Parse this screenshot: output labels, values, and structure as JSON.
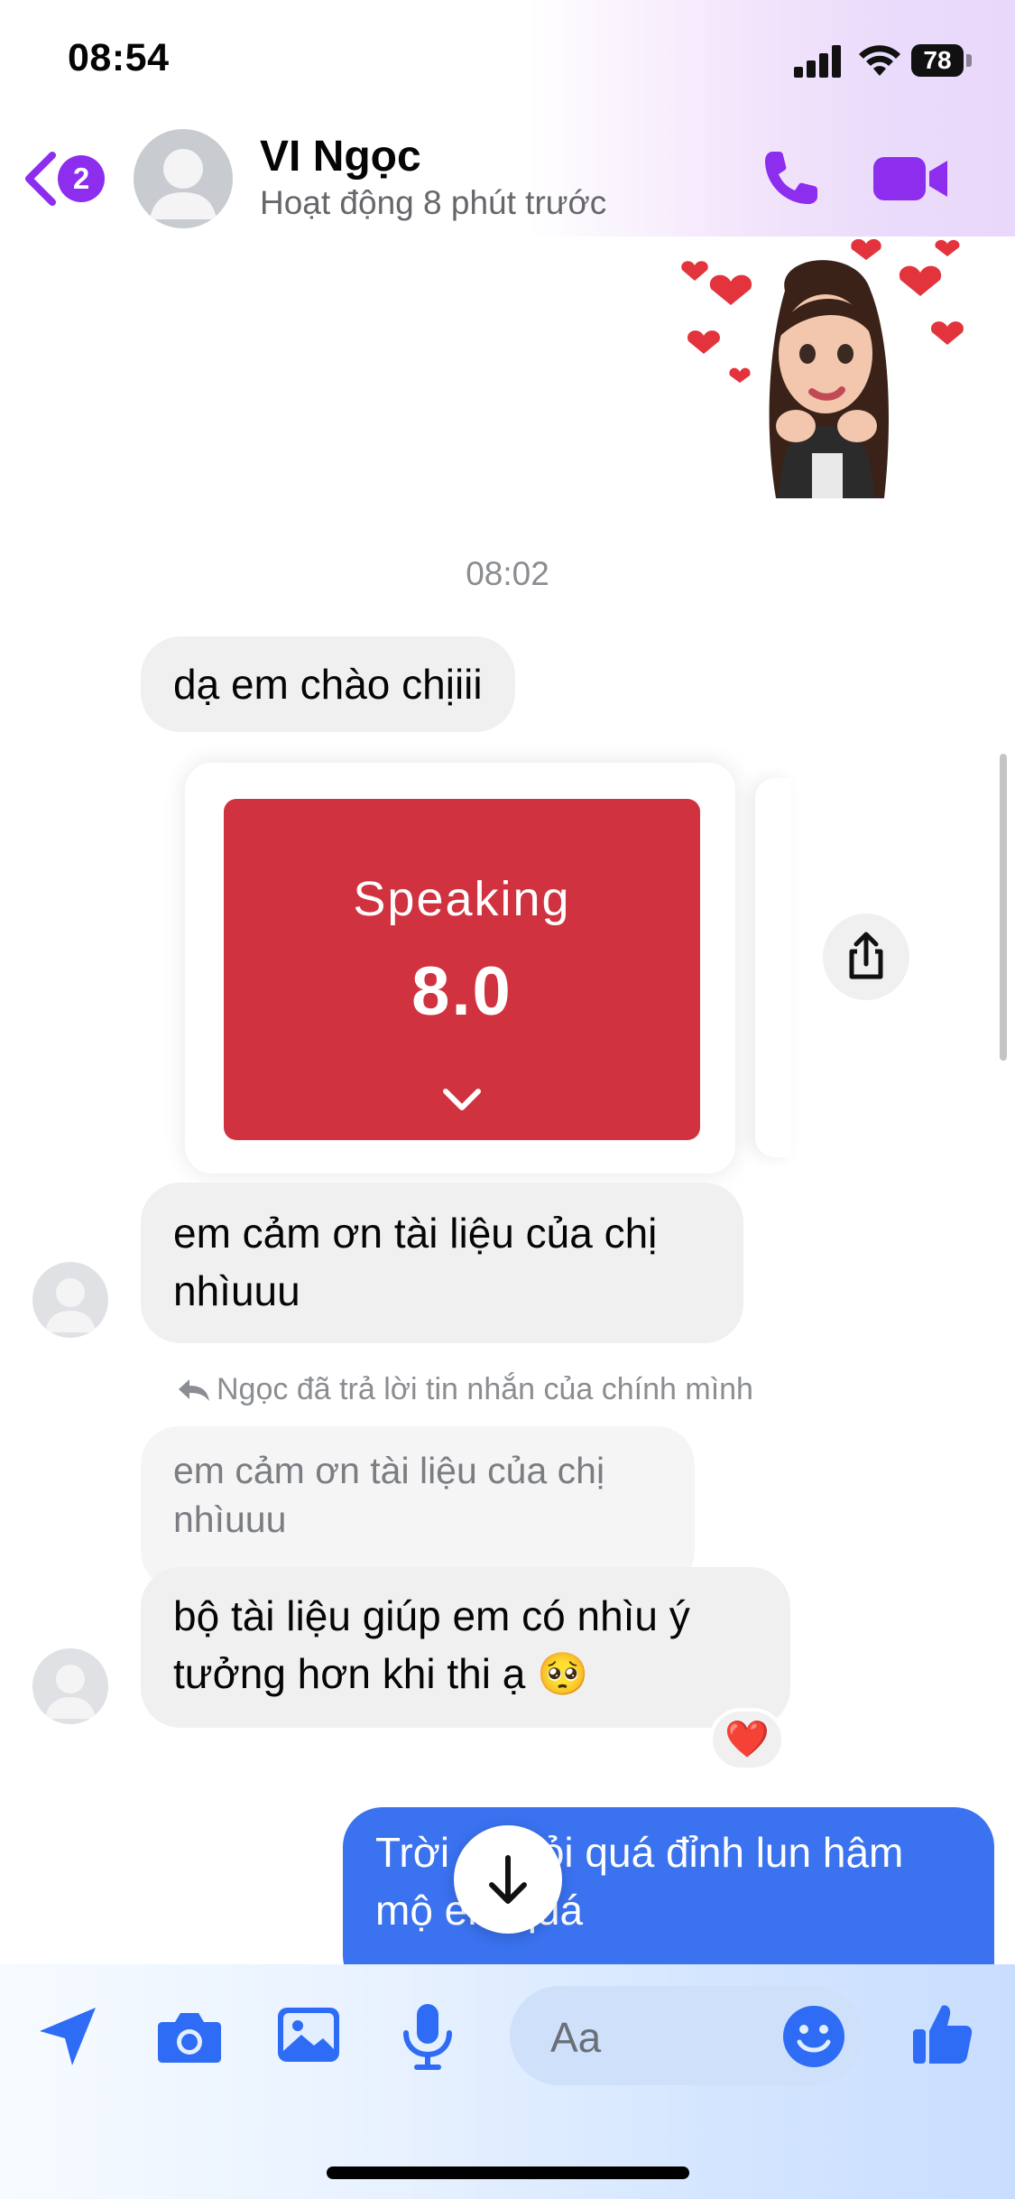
{
  "status_bar": {
    "time": "08:54",
    "battery": "78"
  },
  "header": {
    "back_badge": "2",
    "contact_name": "VI Ngọc",
    "contact_status": "Hoạt động 8 phút trước"
  },
  "conversation": {
    "time_separator": "08:02",
    "msg1": "dạ em chào chịiii",
    "score_card": {
      "label": "Speaking",
      "value": "8.0"
    },
    "msg2": "em cảm ơn tài liệu của chị nhìuuu",
    "reply_note": "Ngọc đã trả lời tin nhắn của chính mình",
    "quoted_text": "em cảm ơn tài liệu của chị nhìuuu",
    "msg3": "bộ tài liệu giúp em có nhìu ý tưởng hơn khi thi ạ 🥺",
    "msg3_reaction": "❤️",
    "msg_out": "Trời ơi giỏi quá đỉnh lun hâm mộ em quá"
  },
  "composer": {
    "placeholder": "Aa"
  },
  "colors": {
    "accent_purple": "#8d2dee",
    "outgoing_bubble": "#3a72f0",
    "incoming_bubble": "#f0f0f0",
    "score_card_red": "#d1323f",
    "composer_icon_blue": "#2e6cf6"
  }
}
